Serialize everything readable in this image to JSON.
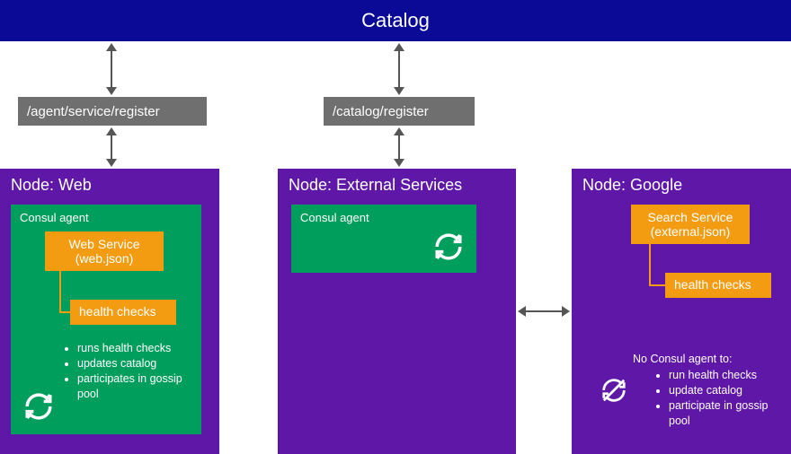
{
  "catalog_title": "Catalog",
  "endpoints": {
    "agent_register": "/agent/service/register",
    "catalog_register": "/catalog/register"
  },
  "nodes": {
    "web": {
      "title": "Node: Web",
      "agent_label": "Consul agent",
      "service_name": "Web Service",
      "service_file": "(web.json)",
      "health_label": "health checks",
      "bullets": [
        "runs health checks",
        "updates catalog",
        "participates in gossip pool"
      ]
    },
    "external": {
      "title": "Node: External Services",
      "agent_label": "Consul agent"
    },
    "google": {
      "title": "Node: Google",
      "service_name": "Search Service",
      "service_file": "(external.json)",
      "health_label": "health checks",
      "no_agent_title": "No Consul agent to:",
      "bullets": [
        "run health checks",
        "update catalog",
        "participate in gossip pool"
      ]
    }
  },
  "colors": {
    "catalog": "#0a0a96",
    "endpoint": "#6f6f6f",
    "node": "#5e17a6",
    "agent": "#009e5d",
    "service": "#f39c12"
  }
}
